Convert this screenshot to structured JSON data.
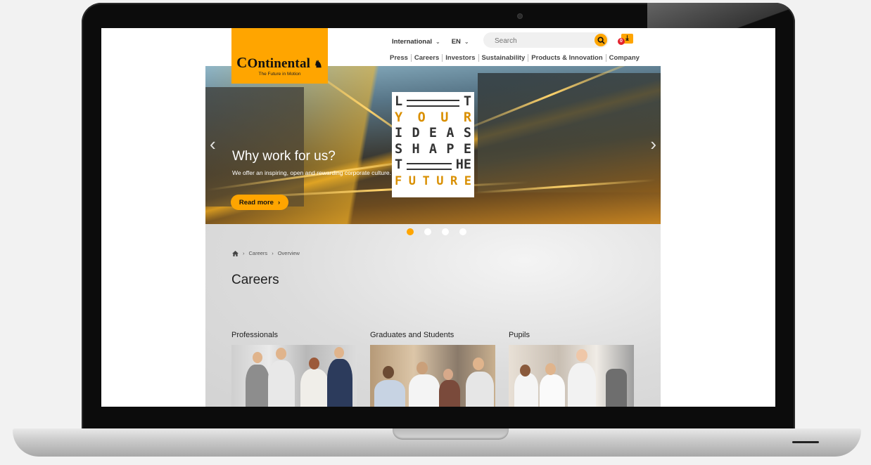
{
  "header": {
    "logo_text": "Ontinental",
    "logo_tagline": "The Future in Motion",
    "international_label": "International",
    "language_label": "EN",
    "search_placeholder": "Search",
    "downloads_count": "0",
    "nav_items": [
      "Press",
      "Careers",
      "Investors",
      "Sustainability",
      "Products & Innovation",
      "Company"
    ]
  },
  "hero": {
    "title": "Why work for us?",
    "text": "We offer an inspiring, open and rewarding corporate culture.",
    "cta_label": "Read more",
    "poster_lines": [
      [
        "L",
        "",
        "",
        "",
        "T"
      ],
      [
        "Y",
        "O",
        "U",
        "R"
      ],
      [
        "I",
        "D",
        "E",
        "A",
        "S"
      ],
      [
        "S",
        "H",
        "A",
        "P",
        "E"
      ],
      [
        "T",
        "",
        "",
        "H",
        "E"
      ],
      [
        "F",
        "U",
        "T",
        "U",
        "R",
        "E"
      ]
    ],
    "slides": 4,
    "active_slide": 1
  },
  "breadcrumb": [
    "Careers",
    "Overview"
  ],
  "page_title": "Careers",
  "cards": [
    {
      "title": "Professionals"
    },
    {
      "title": "Graduates and Students"
    },
    {
      "title": "Pupils"
    }
  ],
  "colors": {
    "brand": "#ffa500",
    "badge": "#e3222d"
  }
}
